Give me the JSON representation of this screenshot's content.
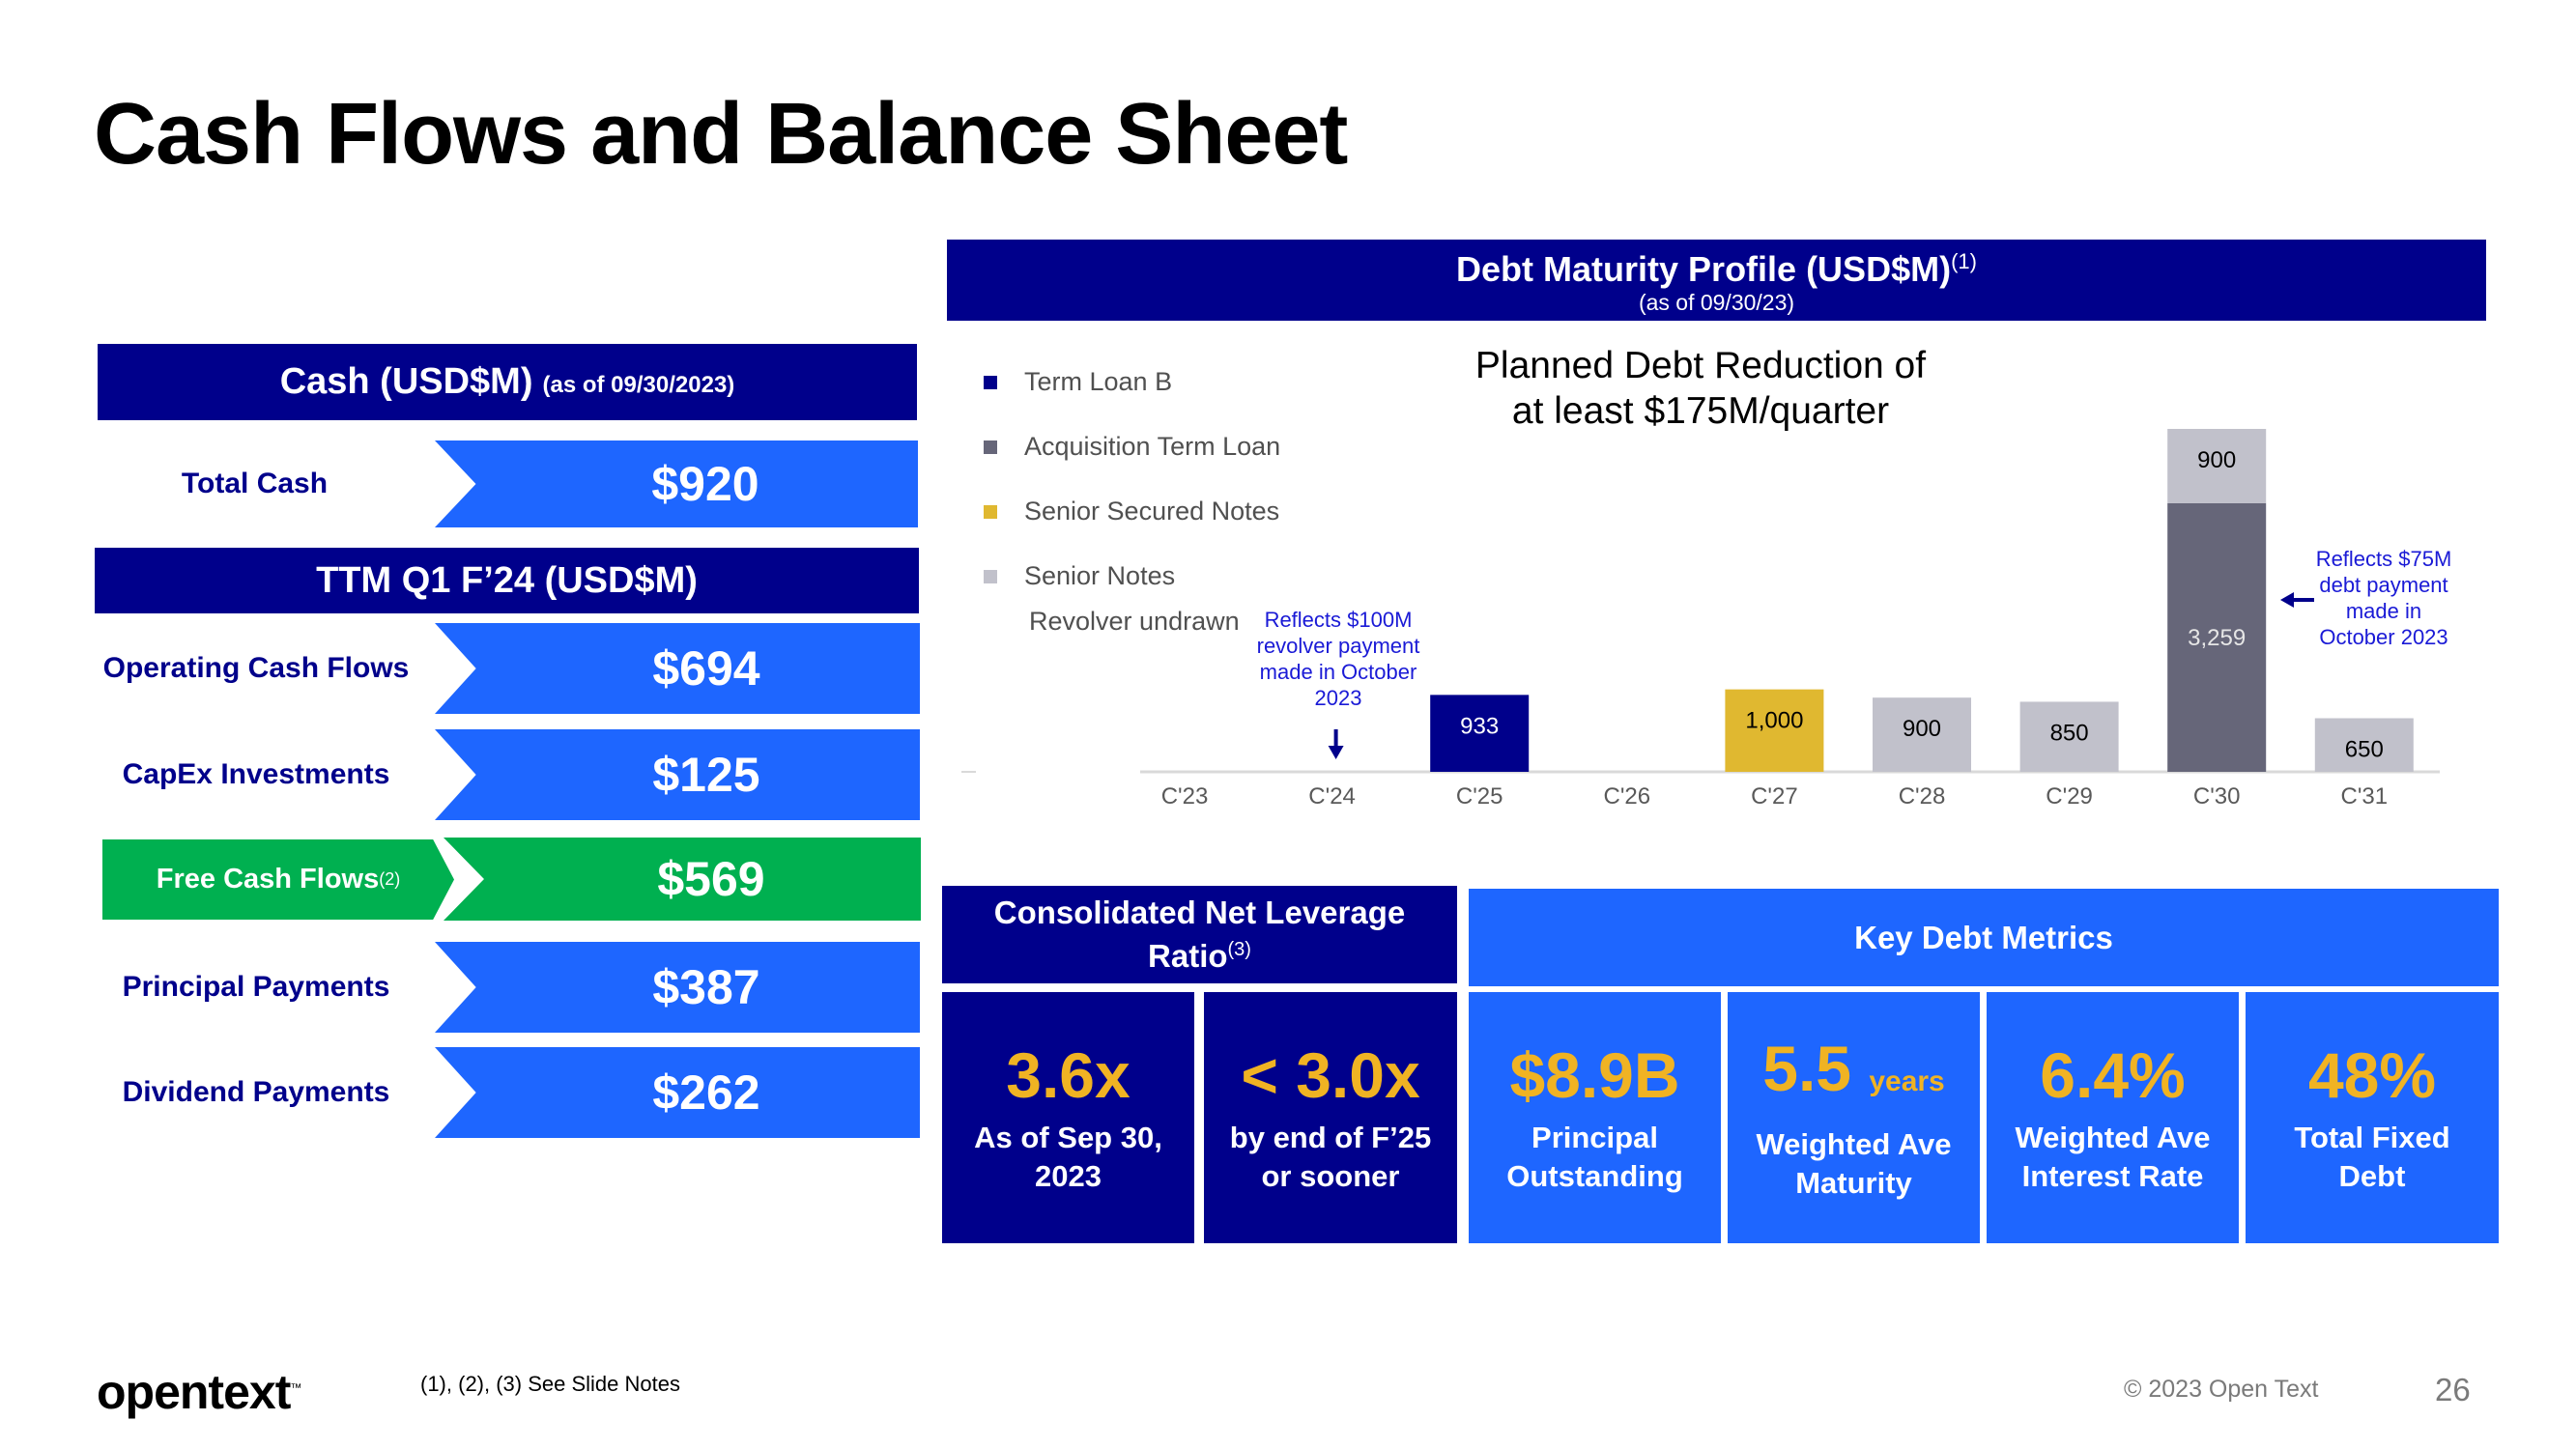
{
  "slide": {
    "title": "Cash Flows and Balance Sheet",
    "page_number": "26",
    "copyright": "© 2023 Open Text",
    "footnote": "(1), (2), (3) See Slide Notes",
    "logo_text": "opentext",
    "logo_tm": "™"
  },
  "cash": {
    "header": "Cash (USD$M)",
    "header_note": "(as of 09/30/2023)",
    "rows": [
      {
        "label": "Total Cash",
        "value": "$920"
      }
    ]
  },
  "ttm": {
    "header": "TTM Q1 F’24 (USD$M)",
    "rows": [
      {
        "label": "Operating Cash Flows",
        "value": "$694"
      },
      {
        "label": "CapEx Investments",
        "value": "$125"
      },
      {
        "label": "Free Cash Flows",
        "label_sup": "(2)",
        "value": "$569",
        "highlight": "green"
      },
      {
        "label": "Principal Payments",
        "value": "$387"
      },
      {
        "label": "Dividend Payments",
        "value": "$262"
      }
    ]
  },
  "debt_profile": {
    "title": "Debt Maturity Profile (USD$M)",
    "title_sup": "(1)",
    "subtitle": "(as of 09/30/23)",
    "planned_note": "Planned Debt Reduction of at least $175M/quarter",
    "planned_line1": "Planned Debt Reduction of",
    "planned_line2": "at least $175M/quarter",
    "revolver_label": "Revolver undrawn",
    "annotation_c24": "Reflects $100M revolver payment made in October 2023",
    "annotation_c30": "Reflects $75M debt payment made in October 2023"
  },
  "chart_data": {
    "type": "bar",
    "stacked": true,
    "title": "Debt Maturity Profile (USD$M)",
    "subtitle": "(as of 09/30/23)",
    "xlabel": "",
    "ylabel": "",
    "categories": [
      "C'23",
      "C'24",
      "C'25",
      "C'26",
      "C'27",
      "C'28",
      "C'29",
      "C'30",
      "C'31"
    ],
    "series": [
      {
        "name": "Term Loan B",
        "color": "#00008b",
        "label_color": "#ffffff",
        "values": [
          0,
          0,
          933,
          0,
          0,
          0,
          0,
          0,
          0
        ]
      },
      {
        "name": "Acquisition Term Loan",
        "color": "#666679",
        "label_color": "#e6e6e6",
        "values": [
          0,
          0,
          0,
          0,
          0,
          0,
          0,
          3259,
          0
        ]
      },
      {
        "name": "Senior Secured Notes",
        "color": "#e0b830",
        "label_color": "#000000",
        "values": [
          0,
          0,
          0,
          0,
          1000,
          0,
          0,
          0,
          0
        ]
      },
      {
        "name": "Senior Notes",
        "color": "#c1c1cb",
        "label_color": "#000000",
        "values": [
          0,
          0,
          0,
          0,
          0,
          900,
          850,
          900,
          650
        ]
      }
    ],
    "data_labels": [
      {
        "category": "C'25",
        "series": "Term Loan B",
        "text": "933"
      },
      {
        "category": "C'27",
        "series": "Senior Secured Notes",
        "text": "1,000"
      },
      {
        "category": "C'28",
        "series": "Senior Notes",
        "text": "900"
      },
      {
        "category": "C'29",
        "series": "Senior Notes",
        "text": "850"
      },
      {
        "category": "C'30",
        "series": "Acquisition Term Loan",
        "text": "3,259"
      },
      {
        "category": "C'30",
        "series": "Senior Notes",
        "text": "900"
      },
      {
        "category": "C'31",
        "series": "Senior Notes",
        "text": "650"
      }
    ],
    "ylim": [
      0,
      4159
    ],
    "grid": false,
    "legend_position": "top-left",
    "annotations": [
      {
        "category": "C'24",
        "text": "Reflects $100M revolver payment made in October 2023",
        "arrow": "down"
      },
      {
        "category": "C'30",
        "text": "Reflects $75M debt payment made in October 2023",
        "arrow": "left"
      }
    ]
  },
  "leverage": {
    "header": "Consolidated Net Leverage Ratio",
    "header_sup": "(3)",
    "metrics": [
      {
        "value": "3.6x",
        "label_line1": "As of Sep 30,",
        "label_line2": "2023"
      },
      {
        "value": "< 3.0x",
        "label_line1": "by end of F’25",
        "label_line2": "or sooner"
      }
    ]
  },
  "key_debt": {
    "header": "Key Debt Metrics",
    "metrics": [
      {
        "value": "$8.9B",
        "unit": "",
        "label_line1": "Principal",
        "label_line2": "Outstanding"
      },
      {
        "value": "5.5",
        "unit": "years",
        "label_line1": "Weighted Ave",
        "label_line2": "Maturity"
      },
      {
        "value": "6.4%",
        "unit": "",
        "label_line1": "Weighted Ave",
        "label_line2": "Interest Rate"
      },
      {
        "value": "48%",
        "unit": "",
        "label_line1": "Total Fixed",
        "label_line2": "Debt"
      }
    ]
  }
}
